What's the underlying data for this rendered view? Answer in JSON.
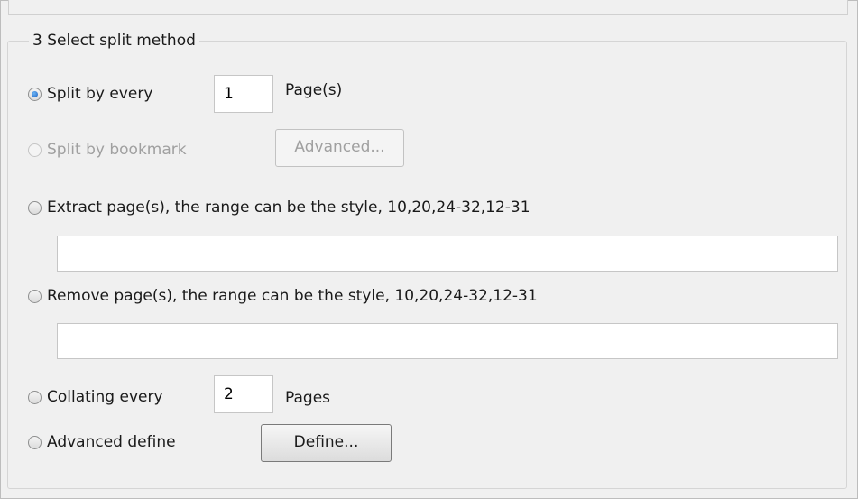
{
  "group": {
    "title": "3 Select split method"
  },
  "options": {
    "split_every": {
      "label": "Split by every",
      "value": "1",
      "unit": "Page(s)",
      "checked": true
    },
    "split_bookmark": {
      "label": "Split by bookmark",
      "button": "Advanced...",
      "enabled": false
    },
    "extract": {
      "label": "Extract page(s), the range can be the style, 10,20,24-32,12-31",
      "value": ""
    },
    "remove": {
      "label": "Remove page(s), the range can be the style, 10,20,24-32,12-31",
      "value": ""
    },
    "collating": {
      "label": "Collating every",
      "value": "2",
      "unit": "Pages"
    },
    "advanced": {
      "label": "Advanced define",
      "button": "Define..."
    }
  }
}
